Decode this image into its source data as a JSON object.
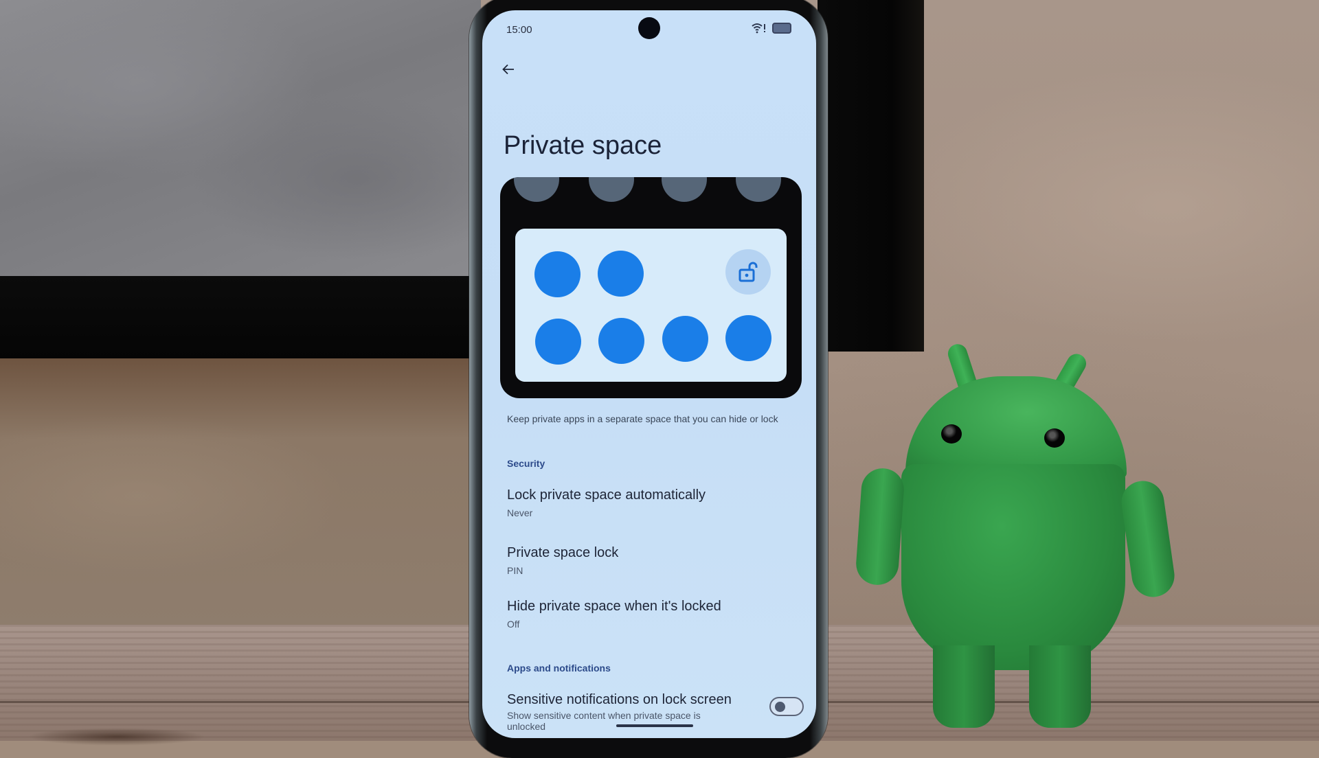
{
  "status_bar": {
    "time": "15:00",
    "icons": [
      "wifi-no-internet-icon",
      "battery-icon"
    ]
  },
  "header": {
    "back_icon": "arrow-left-icon",
    "title": "Private space"
  },
  "illustration": {
    "top_app_count": 4,
    "grid_app_count": 6,
    "lock_state_icon": "lock-open-icon",
    "accent_color": "#1a7ee8"
  },
  "description": "Keep private apps in a separate space that you can hide or lock",
  "sections": [
    {
      "header": "Security",
      "items": [
        {
          "title": "Lock private space automatically",
          "summary": "Never"
        },
        {
          "title": "Private space lock",
          "summary": "PIN"
        },
        {
          "title": "Hide private space when it's locked",
          "summary": "Off"
        }
      ]
    },
    {
      "header": "Apps and notifications",
      "items": [
        {
          "title": "Sensitive notifications on lock screen",
          "summary": "Show sensitive content when private space is unlocked",
          "toggle": false
        }
      ]
    }
  ],
  "colors": {
    "screen_background": "#c8e0f8",
    "section_header": "#2c4a8a",
    "app_icon_blue": "#1a7ee8"
  }
}
